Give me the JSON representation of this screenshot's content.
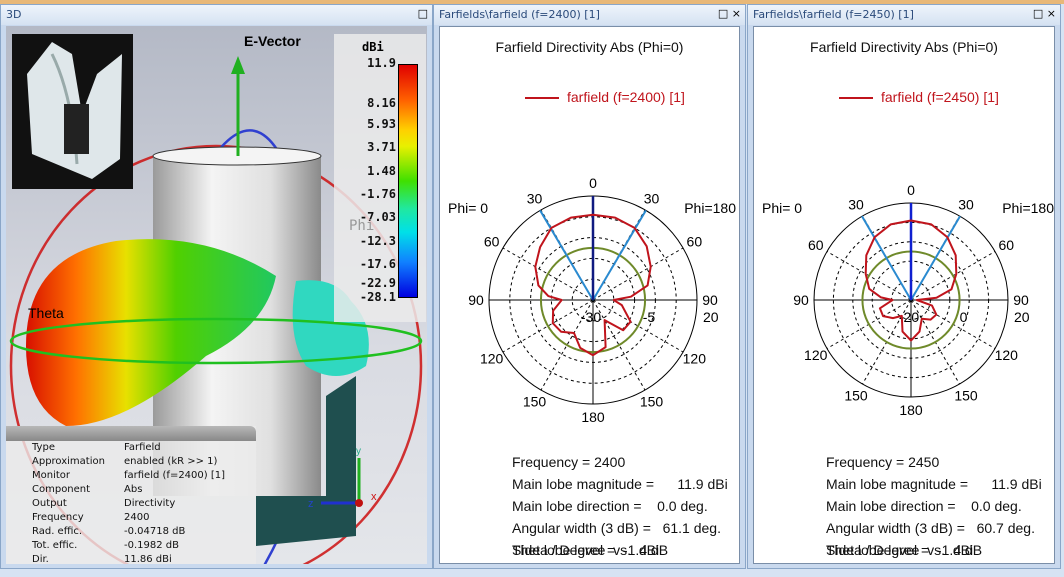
{
  "panels": {
    "view3d": {
      "title": "3D",
      "maximize": "□",
      "e_vector_label": "E-Vector",
      "theta_label": "Theta",
      "phi_label": "Phi",
      "colorbar": {
        "unit": "dBi",
        "ticks": [
          "11.9",
          "8.16",
          "5.93",
          "3.71",
          "1.48",
          "-1.76",
          "-7.03",
          "-12.3",
          "-17.6",
          "-22.9",
          "-28.1"
        ]
      },
      "axes": {
        "x": "x",
        "y": "y",
        "z": "z"
      },
      "info": [
        {
          "key": "Type",
          "value": "Farfield"
        },
        {
          "key": "Approximation",
          "value": "enabled (kR >> 1)"
        },
        {
          "key": "Monitor",
          "value": "farfield (f=2400) [1]"
        },
        {
          "key": "Component",
          "value": "Abs"
        },
        {
          "key": "Output",
          "value": "Directivity"
        },
        {
          "key": "Frequency",
          "value": "2400"
        },
        {
          "key": "Rad. effic.",
          "value": "-0.04718 dB"
        },
        {
          "key": "Tot. effic.",
          "value": "-0.1982 dB"
        },
        {
          "key": "Dir.",
          "value": "11.86 dBi"
        }
      ]
    },
    "polar1": {
      "title": "Farfields\\farfield (f=2400) [1]",
      "maximize": "□",
      "close": "×",
      "stats": {
        "frequency": "Frequency = 2400",
        "mag": "Main lobe magnitude =      11.9 dBi",
        "dir": "Main lobe direction =    0.0 deg.",
        "width": "Angular width (3 dB) =   61.1 deg.",
        "side": "Side lobe level =  -1.4 dB",
        "axis": "Theta / Degree  vs.  dBi"
      }
    },
    "polar2": {
      "title": "Farfields\\farfield (f=2450) [1]",
      "maximize": "□",
      "close": "×",
      "stats": {
        "frequency": "Frequency = 2450",
        "mag": "Main lobe magnitude =      11.9 dBi",
        "dir": "Main lobe direction =    0.0 deg.",
        "width": "Angular width (3 dB) =   60.7 deg.",
        "side": "Side lobe level =  -1.4 dB",
        "axis": "Theta / Degree  vs.  dBi"
      }
    }
  },
  "chart_data": [
    {
      "type": "polar",
      "title": "Farfield Directivity Abs (Phi=0)",
      "legend": "farfield (f=2400) [1]",
      "left_label": "Phi=  0",
      "right_label": "Phi=180",
      "angle_labels": [
        "0",
        "30",
        "60",
        "90",
        "120",
        "150",
        "180",
        "150",
        "120",
        "90",
        "60",
        "30"
      ],
      "radial_labels": [
        "-30",
        "-5",
        "20"
      ],
      "rlim": [
        -30,
        20
      ],
      "theta": [
        -180,
        -165,
        -150,
        -135,
        -120,
        -105,
        -90,
        -85,
        -75,
        -60,
        -45,
        -30,
        -15,
        0,
        15,
        30,
        45,
        60,
        75,
        85,
        90,
        100,
        120,
        135,
        150,
        165,
        180
      ],
      "values": [
        9.25,
        8.6,
        7.0,
        8.0,
        8.2,
        7.5,
        5.8,
        8.0,
        9.4,
        10.4,
        11.1,
        11.75,
        11.9,
        11.9,
        11.9,
        11.75,
        11.2,
        10.4,
        9.4,
        7.0,
        3.3,
        5.4,
        7.8,
        7.7,
        4.0,
        8.5,
        9.25
      ],
      "main_lobe_deg": 0,
      "beamwidth_deg": 61.1,
      "threshold_db": 8.9,
      "color": "#c0141c"
    },
    {
      "type": "polar",
      "title": "Farfield Directivity Abs (Phi=0)",
      "legend": "farfield (f=2450) [1]",
      "left_label": "Phi=  0",
      "right_label": "Phi=180",
      "angle_labels": [
        "0",
        "30",
        "60",
        "90",
        "120",
        "150",
        "180",
        "150",
        "120",
        "90",
        "60",
        "30"
      ],
      "radial_labels": [
        "-20",
        "0",
        "20"
      ],
      "rlim": [
        -20,
        20
      ],
      "theta": [
        -180,
        -165,
        -150,
        -135,
        -120,
        -105,
        -90,
        -85,
        -75,
        -60,
        -45,
        -30,
        -15,
        0,
        15,
        30,
        45,
        60,
        75,
        85,
        90,
        105,
        120,
        135,
        150,
        165,
        180
      ],
      "values": [
        7.8,
        6.5,
        3.0,
        5.0,
        6.4,
        6.4,
        3.0,
        6.0,
        8.2,
        9.35,
        10.5,
        11.35,
        11.8,
        11.9,
        11.8,
        11.35,
        10.5,
        9.35,
        8.0,
        5.0,
        -4,
        4.0,
        5.8,
        5.5,
        4.0,
        6.5,
        7.8
      ],
      "main_lobe_deg": 0,
      "beamwidth_deg": 60.7,
      "threshold_db": 8.9,
      "color": "#c0141c"
    }
  ]
}
